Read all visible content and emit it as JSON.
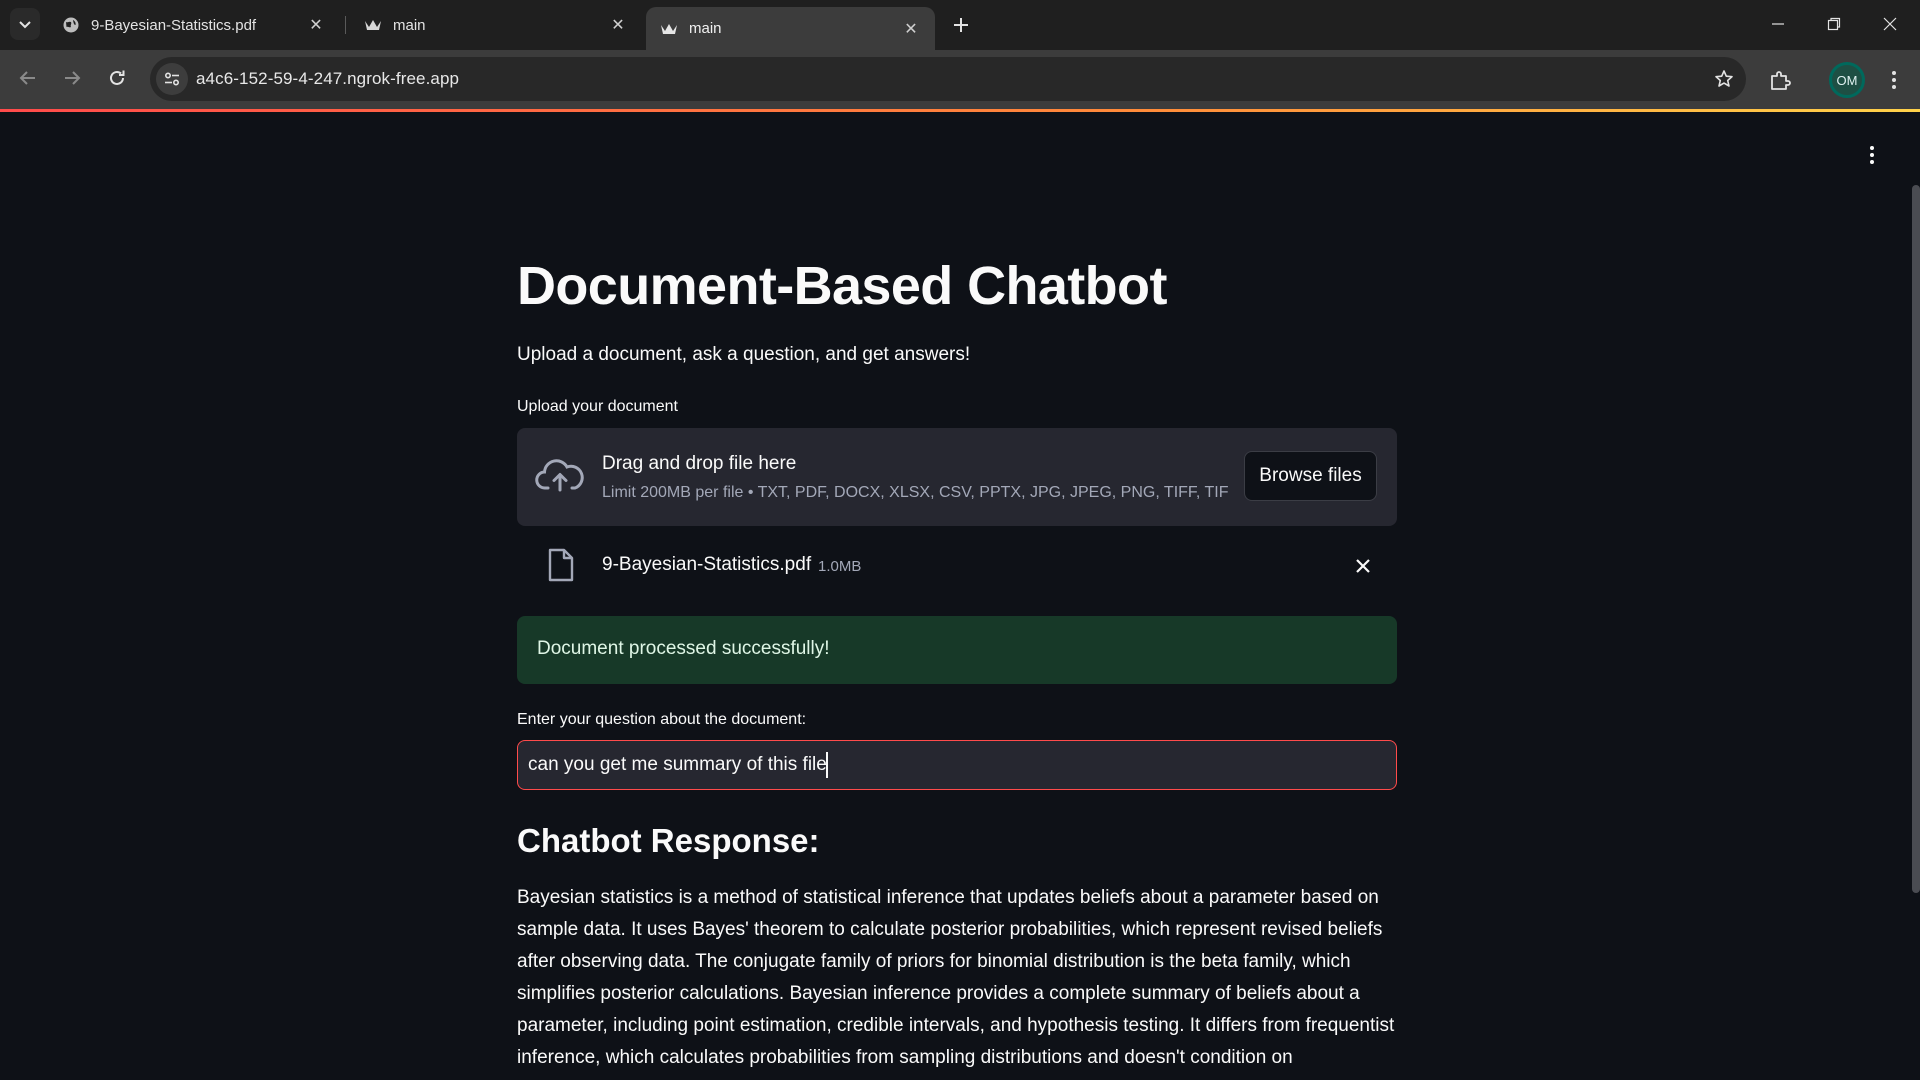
{
  "browser": {
    "tabs": [
      {
        "title": "9-Bayesian-Statistics.pdf",
        "active": false,
        "favicon": "globe-icon"
      },
      {
        "title": "main",
        "active": false,
        "favicon": "streamlit-crown-icon"
      },
      {
        "title": "main",
        "active": true,
        "favicon": "streamlit-crown-icon"
      }
    ],
    "url": "a4c6-152-59-4-247.ngrok-free.app",
    "profile_initials": "OM"
  },
  "app": {
    "title": "Document-Based Chatbot",
    "subtitle": "Upload a document, ask a question, and get answers!",
    "uploader": {
      "label": "Upload your document",
      "drop_text": "Drag and drop file here",
      "limit_text": "Limit 200MB per file • TXT, PDF, DOCX, XLSX, CSV, PPTX, JPG, JPEG, PNG, TIFF, TIF",
      "browse_label": "Browse files",
      "file": {
        "name": "9-Bayesian-Statistics.pdf",
        "size": "1.0MB"
      }
    },
    "success_message": "Document processed successfully!",
    "question": {
      "label": "Enter your question about the document:",
      "value": "can you get me summary of this file"
    },
    "response": {
      "heading": "Chatbot Response:",
      "text": "Bayesian statistics is a method of statistical inference that updates beliefs about a parameter based on sample data. It uses Bayes' theorem to calculate posterior probabilities, which represent revised beliefs after observing data. The conjugate family of priors for binomial distribution is the beta family, which simplifies posterior calculations. Bayesian inference provides a complete summary of beliefs about a parameter, including point estimation, credible intervals, and hypothesis testing. It differs from frequentist inference, which calculates probabilities from sampling distributions and doesn't condition on"
    }
  },
  "colors": {
    "background": "#0e1117",
    "surface": "#262730",
    "accent": "#ff4b4b",
    "success_bg": "#173928",
    "profile": "#00695c"
  }
}
